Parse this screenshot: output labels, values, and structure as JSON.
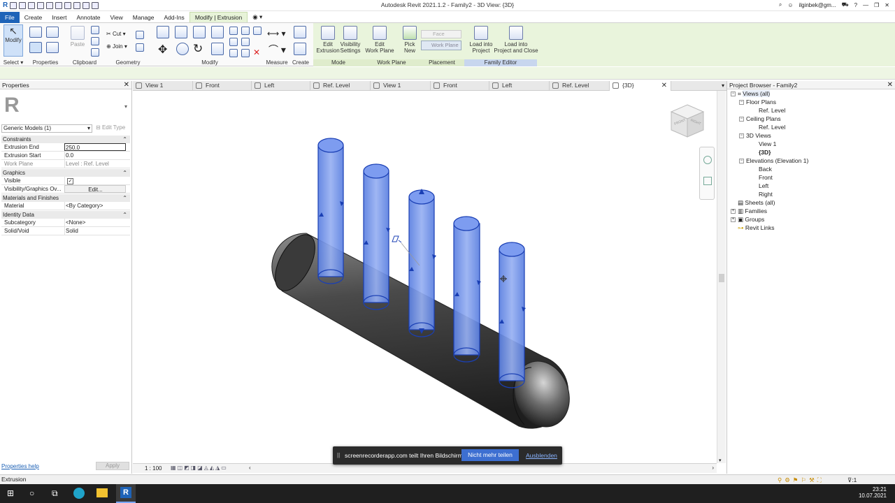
{
  "app": {
    "title": "Autodesk Revit 2021.1.2 - Family2 - 3D View: {3D}",
    "user": "ilginbek@gm..."
  },
  "menu": {
    "tabs": [
      "File",
      "Create",
      "Insert",
      "Annotate",
      "View",
      "Manage",
      "Add-Ins",
      "Modify | Extrusion"
    ],
    "active": "Modify | Extrusion"
  },
  "ribbon": {
    "modify_label": "Modify",
    "select_label": "Select",
    "properties_label": "Properties",
    "clipboard_label": "Clipboard",
    "paste_label": "Paste",
    "cut_label": "Cut",
    "join_label": "Join",
    "geometry_label": "Geometry",
    "modify_group_label": "Modify",
    "measure_label": "Measure",
    "create_label": "Create",
    "mode_label": "Mode",
    "workplane_group_label": "Work Plane",
    "placement_label": "Placement",
    "family_editor_label": "Family Editor",
    "edit_extrusion": [
      "Edit",
      "Extrusion"
    ],
    "visibility_settings": [
      "Visibility",
      "Settings"
    ],
    "edit_work_plane": [
      "Edit",
      "Work Plane"
    ],
    "pick_new": [
      "Pick",
      "New"
    ],
    "face_label": "Face",
    "work_plane_label": "Work Plane",
    "load_into_project": [
      "Load into",
      "Project"
    ],
    "load_into_project_close": [
      "Load into",
      "Project and Close"
    ]
  },
  "properties": {
    "title": "Properties",
    "type_selector": "Generic Models (1)",
    "edit_type": "Edit Type",
    "sections": {
      "constraints": "Constraints",
      "graphics": "Graphics",
      "materials": "Materials and Finishes",
      "identity": "Identity Data"
    },
    "rows": {
      "extrusion_end": {
        "k": "Extrusion End",
        "v": "250.0"
      },
      "extrusion_start": {
        "k": "Extrusion Start",
        "v": "0.0"
      },
      "work_plane": {
        "k": "Work Plane",
        "v": "Level : Ref. Level"
      },
      "visible": {
        "k": "Visible",
        "v": "✓"
      },
      "vis_graphics": {
        "k": "Visibility/Graphics Ov...",
        "v": "Edit..."
      },
      "material": {
        "k": "Material",
        "v": "<By Category>"
      },
      "subcategory": {
        "k": "Subcategory",
        "v": "<None>"
      },
      "solid_void": {
        "k": "Solid/Void",
        "v": "Solid"
      }
    },
    "help": "Properties help",
    "apply": "Apply"
  },
  "view_tabs": [
    "View 1",
    "Front",
    "Left",
    "Ref. Level",
    "View 1",
    "Front",
    "Left",
    "Ref. Level",
    "{3D}"
  ],
  "viewbar": {
    "scale": "1 : 100"
  },
  "browser": {
    "title": "Project Browser - Family2",
    "items": [
      {
        "label": "Views (all)",
        "level": 0
      },
      {
        "label": "Floor Plans",
        "level": 1
      },
      {
        "label": "Ref. Level",
        "level": 2
      },
      {
        "label": "Ceiling Plans",
        "level": 1
      },
      {
        "label": "Ref. Level",
        "level": 2
      },
      {
        "label": "3D Views",
        "level": 1
      },
      {
        "label": "View 1",
        "level": 2
      },
      {
        "label": "{3D}",
        "level": 2
      },
      {
        "label": "Elevations (Elevation 1)",
        "level": 1
      },
      {
        "label": "Back",
        "level": 2
      },
      {
        "label": "Front",
        "level": 2
      },
      {
        "label": "Left",
        "level": 2
      },
      {
        "label": "Right",
        "level": 2
      },
      {
        "label": "Sheets (all)",
        "level": 0
      },
      {
        "label": "Families",
        "level": 0
      },
      {
        "label": "Groups",
        "level": 0
      },
      {
        "label": "Revit Links",
        "level": 0
      }
    ]
  },
  "share": {
    "text": "screenrecorderapp.com teilt Ihren Bildschirm.",
    "stop": "Nicht mehr teilen",
    "hide": "Ausblenden"
  },
  "status": {
    "text": "Extrusion",
    "filter_count": ":1"
  },
  "taskbar": {
    "time": "23:21",
    "date": "10.07.2021"
  },
  "viewcube": {
    "front": "FRONT",
    "right": "RIGHT"
  },
  "colors": {
    "cylinder_blue": "#6f8fe6",
    "tank_grey": "#555555",
    "context_green": "#e9f4dc",
    "file_blue": "#1e63b8"
  }
}
